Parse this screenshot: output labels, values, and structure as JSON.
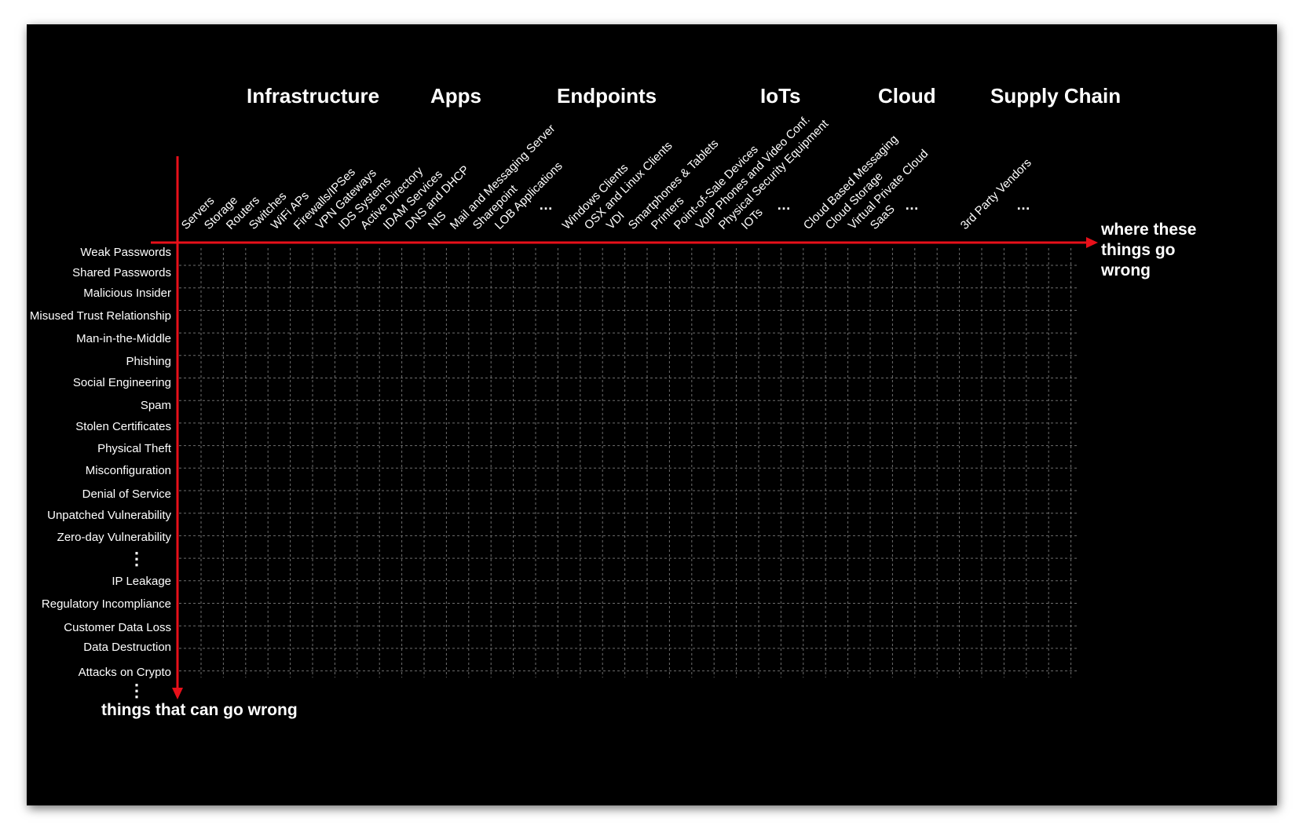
{
  "colors": {
    "background": "#000000",
    "axis": "#e8101a",
    "grid": "#6e6e6e",
    "text": "#ffffff"
  },
  "categories": [
    {
      "title": "Infrastructure"
    },
    {
      "title": "Apps"
    },
    {
      "title": "Endpoints"
    },
    {
      "title": "IoTs"
    },
    {
      "title": "Cloud"
    },
    {
      "title": "Supply Chain"
    }
  ],
  "columns": [
    "Servers",
    "Storage",
    "Routers",
    "Switches",
    "WiFi APs",
    "Firewalls/IPSes",
    "VPN Gateways",
    "IDS Systems",
    "Active Directory",
    "IDAM Services",
    "DNS and DHCP",
    "NIS",
    "Mail and Messaging Server",
    "Sharepoint",
    "LOB Applications",
    "…",
    "Windows Clients",
    "OSX and Linux Clients",
    "VDI",
    "Smartphones & Tablets",
    "Printers",
    "Point-of-Sale Devices",
    "VoIP Phones and Video Conf.",
    "Physical Security Equipment",
    "IOTs",
    "…",
    "Cloud Based Messaging",
    "Cloud Storage",
    "Virtual Private Cloud",
    "SaaS",
    "…",
    "3rd Party Vendors",
    "…"
  ],
  "rows": [
    "Weak Passwords",
    "Shared Passwords",
    "Malicious Insider",
    "Misused Trust Relationship",
    "Man-in-the-Middle",
    "Phishing",
    "Social Engineering",
    "Spam",
    "Stolen Certificates",
    "Physical Theft",
    "Misconfiguration",
    "Denial of Service",
    "Unpatched Vulnerability",
    "Zero-day Vulnerability",
    "⋮",
    "IP Leakage",
    "Regulatory Incompliance",
    "Customer Data Loss",
    "Data Destruction",
    "Attacks on Crypto"
  ],
  "bottom_ellipsis": "⋮",
  "x_axis_label": [
    "where these",
    "things go",
    "wrong"
  ],
  "y_axis_label": "things that can go wrong"
}
